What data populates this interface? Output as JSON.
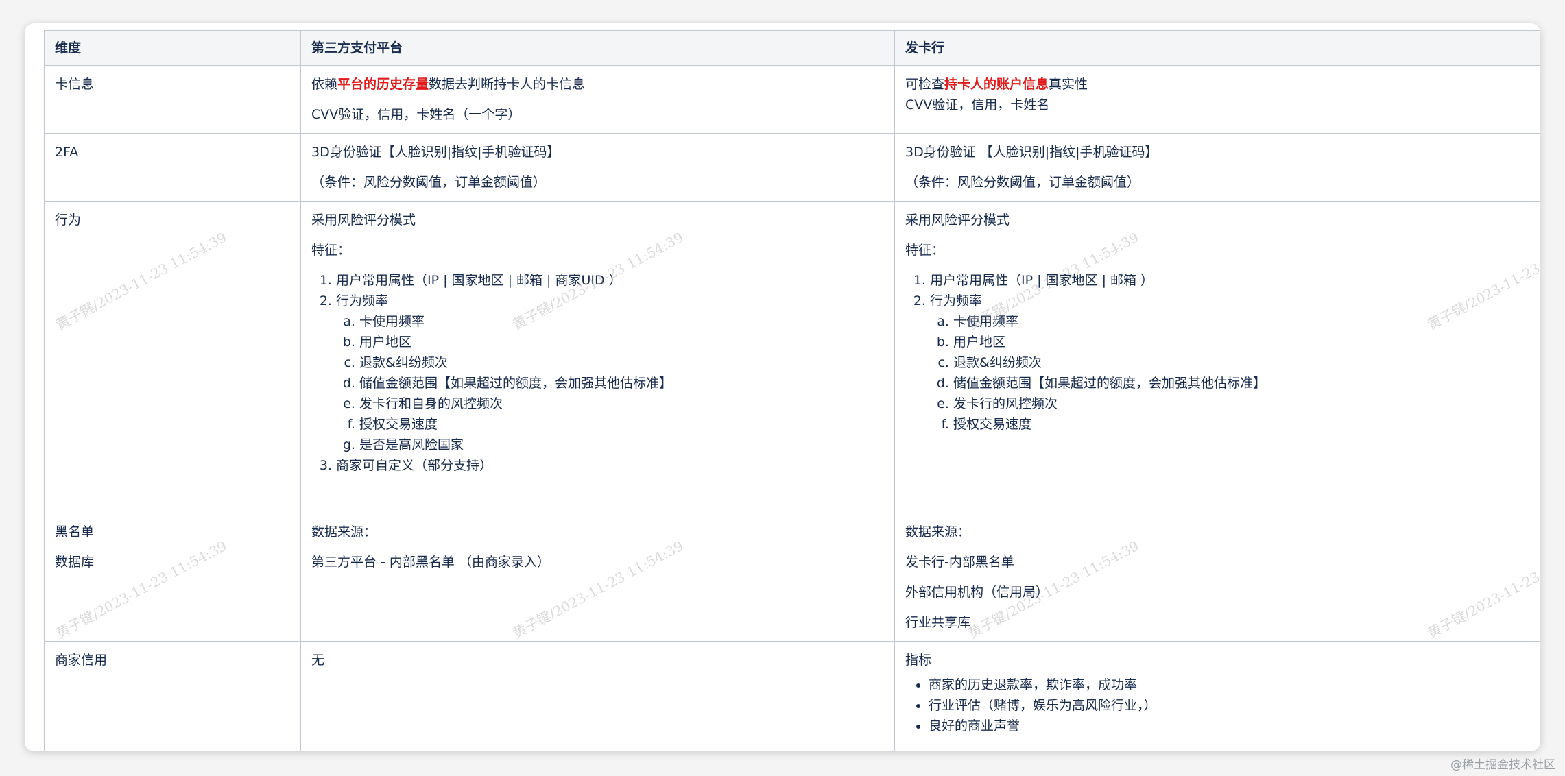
{
  "table": {
    "headers": [
      "维度",
      "第三方支付平台",
      "发卡行"
    ],
    "card_info": {
      "label": "卡信息",
      "platform_prefix": "依赖",
      "platform_highlight": "平台的历史存量",
      "platform_suffix": "数据去判断持卡人的卡信息",
      "platform_line2": "CVV验证，信用，卡姓名（一个字）",
      "issuer_prefix": "可检查",
      "issuer_highlight": "持卡人的账户信息",
      "issuer_suffix": "真实性",
      "issuer_line2": "CVV验证，信用，卡姓名"
    },
    "twofa": {
      "label": "2FA",
      "platform_line1": "3D身份验证【人脸识别|指纹|手机验证码】",
      "platform_line2": "（条件：风险分数阈值，订单金额阈值）",
      "issuer_line1": "3D身份验证 【人脸识别|指纹|手机验证码】",
      "issuer_line2": "（条件：风险分数阈值，订单金额阈值）"
    },
    "behavior": {
      "label": "行为",
      "platform": {
        "line1": "采用风险评分模式",
        "line2": "特征：",
        "item1": "用户常用属性（IP | 国家地区 | 邮箱 | 商家UID ）",
        "item2": "行为频率",
        "sub": [
          "卡使用频率",
          "用户地区",
          "退款&纠纷频次",
          "储值金额范围【如果超过的额度，会加强其他估标准】",
          "发卡行和自身的风控频次",
          "授权交易速度",
          "是否是高风险国家"
        ],
        "item3": "商家可自定义（部分支持）"
      },
      "issuer": {
        "line1": "采用风险评分模式",
        "line2": "特征：",
        "item1": "用户常用属性（IP | 国家地区 | 邮箱 ）",
        "item2": "行为频率",
        "sub": [
          "卡使用频率",
          "用户地区",
          "退款&纠纷频次",
          "储值金额范围【如果超过的额度，会加强其他估标准】",
          "发卡行的风控频次",
          "授权交易速度"
        ]
      }
    },
    "blacklist": {
      "label_line1": "黑名单",
      "label_line2": "数据库",
      "platform_line1": "数据来源：",
      "platform_line2": "第三方平台 - 内部黑名单 （由商家录入）",
      "issuer_line1": "数据来源：",
      "issuer_line2": "发卡行-内部黑名单",
      "issuer_line3": "外部信用机构（信用局）",
      "issuer_line4": "行业共享库"
    },
    "merchant": {
      "label": "商家信用",
      "platform": "无",
      "issuer_line1": "指标",
      "issuer_items": [
        "商家的历史退款率，欺诈率，成功率",
        "行业评估（赌博，娱乐为高风险行业，）",
        "良好的商业声誉"
      ]
    }
  },
  "watermark": "黄子键/2023-11-23 11:54:39",
  "credit": "@稀土掘金技术社区",
  "colors": {
    "highlight": "#e01b1b",
    "border": "#c1c7d0",
    "header_bg": "#f4f5f7",
    "text": "#172b4d"
  }
}
